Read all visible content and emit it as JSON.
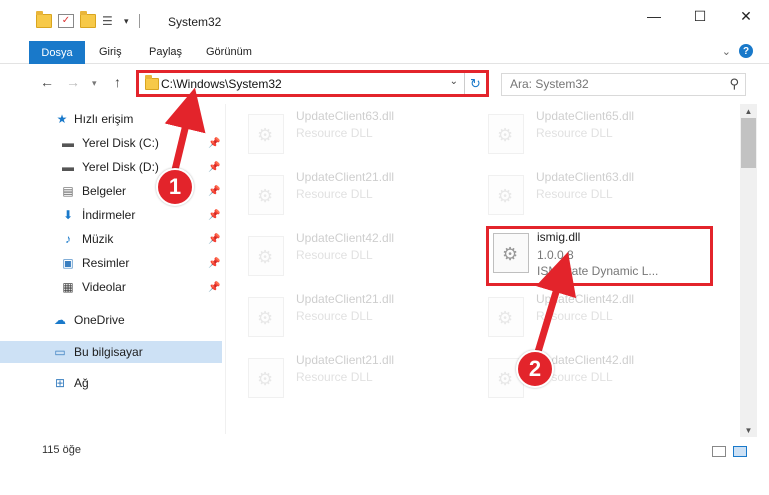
{
  "window": {
    "title": "System32",
    "buttons": {
      "minimize": "—",
      "maximize": "☐",
      "close": "✕"
    }
  },
  "ribbon": {
    "file_tab": "Dosya",
    "tabs": [
      "Giriş",
      "Paylaş",
      "Görünüm"
    ],
    "help": "?"
  },
  "nav": {
    "address": "C:\\Windows\\System32",
    "search_placeholder": "Ara: System32"
  },
  "sidebar": {
    "items": [
      {
        "label": "Hızlı erişim",
        "icon": "star-icon"
      },
      {
        "label": "Yerel Disk (C:)",
        "icon": "drive-icon",
        "pinned": true
      },
      {
        "label": "Yerel Disk (D:)",
        "icon": "drive-icon",
        "pinned": true
      },
      {
        "label": "Belgeler",
        "icon": "document-icon",
        "pinned": true
      },
      {
        "label": "İndirmeler",
        "icon": "download-icon",
        "pinned": true
      },
      {
        "label": "Müzik",
        "icon": "music-icon",
        "pinned": true
      },
      {
        "label": "Resimler",
        "icon": "pictures-icon",
        "pinned": true
      },
      {
        "label": "Videolar",
        "icon": "video-icon",
        "pinned": true
      },
      {
        "label": "OneDrive",
        "icon": "cloud-icon"
      },
      {
        "label": "Bu bilgisayar",
        "icon": "computer-icon",
        "selected": true
      },
      {
        "label": "Ağ",
        "icon": "network-icon"
      }
    ]
  },
  "files": [
    {
      "name": "UpdateClient63.dll",
      "desc": "Resource DLL"
    },
    {
      "name": "UpdateClient65.dll",
      "desc": "Resource DLL"
    },
    {
      "name": "UpdateClient21.dll",
      "desc": "Resource DLL"
    },
    {
      "name": "UpdateClient63.dll",
      "desc": "Resource DLL"
    },
    {
      "name": "UpdateClient42.dll",
      "desc": "Resource DLL"
    },
    {
      "name": "ismig.dll",
      "version": "1.0.0.8",
      "desc": "ISMigrate Dynamic L..."
    },
    {
      "name": "UpdateClient21.dll",
      "desc": "Resource DLL"
    },
    {
      "name": "UpdateClient42.dll",
      "desc": "Resource DLL"
    },
    {
      "name": "UpdateClient21.dll",
      "desc": "Resource DLL"
    },
    {
      "name": "UpdateClient42.dll",
      "desc": "Resource DLL"
    }
  ],
  "status": {
    "count": "115 öğe"
  },
  "callouts": [
    "1",
    "2"
  ],
  "colors": {
    "accent": "#1979ca",
    "highlight": "#e3242b",
    "selected": "#cde1f5"
  }
}
